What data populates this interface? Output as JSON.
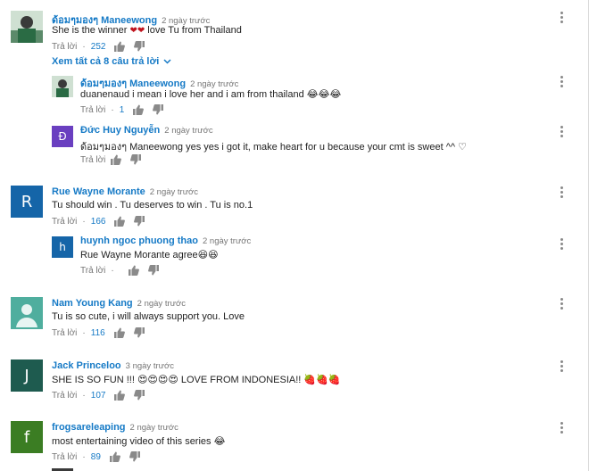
{
  "ui": {
    "reply_label": "Trả lời",
    "dot": "·",
    "view_replies": "Xem tất cả 8 câu trả lời"
  },
  "colors": {
    "link": "#167ac6",
    "meta": "#767676"
  },
  "comments": [
    {
      "author": "ด้อมๆมองๆ Maneewong",
      "time": "2 ngày trước",
      "text_before": "She is the winner ",
      "text_emoji": "❤❤",
      "text_after": " love Tu from Thailand",
      "likes": "252",
      "avatar": "photo"
    },
    {
      "author": "ด้อมๆมองๆ Maneewong",
      "time": "2 ngày trước",
      "text": "duanenaud i mean i love her and i am from thailand 😂😂😂",
      "likes": "1",
      "avatar": "photo"
    },
    {
      "author": "Đức Huy Nguyễn",
      "time": "2 ngày trước",
      "text": "ด้อมๆมองๆ Maneewong yes yes i got it, make heart for u because your cmt is sweet ^^ ♡",
      "likes": "",
      "avatar_letter": "Đ",
      "avatar_color": "#6a3fc0"
    },
    {
      "author": "Rue Wayne Morante",
      "time": "2 ngày trước",
      "text": "Tu should win . Tu deserves to win . Tu is no.1",
      "likes": "166",
      "avatar_letter": "R",
      "avatar_color": "#1565a8"
    },
    {
      "author": "huynh ngoc phuong thao",
      "time": "2 ngày trước",
      "text": "Rue Wayne Morante agree😆😆",
      "likes": "",
      "avatar_letter": "h",
      "avatar_color": "#1565a8"
    },
    {
      "author": "Nam Young Kang",
      "time": "2 ngày trước",
      "text": "Tu is so cute, i will always support you. Love",
      "likes": "116",
      "avatar": "default"
    },
    {
      "author": "Jack Princeloo",
      "time": "3 ngày trước",
      "text": "SHE IS SO FUN !!! 😍😍😍😍 LOVE FROM INDONESIA!! 🍓🍓🍓",
      "likes": "107",
      "avatar_letter": "J",
      "avatar_color": "#1e5b4f"
    },
    {
      "author": "frogsareleaping",
      "time": "2 ngày trước",
      "text": "most entertaining video of this series 😂",
      "likes": "89",
      "avatar_letter": "f",
      "avatar_color": "#3b7d23"
    }
  ]
}
